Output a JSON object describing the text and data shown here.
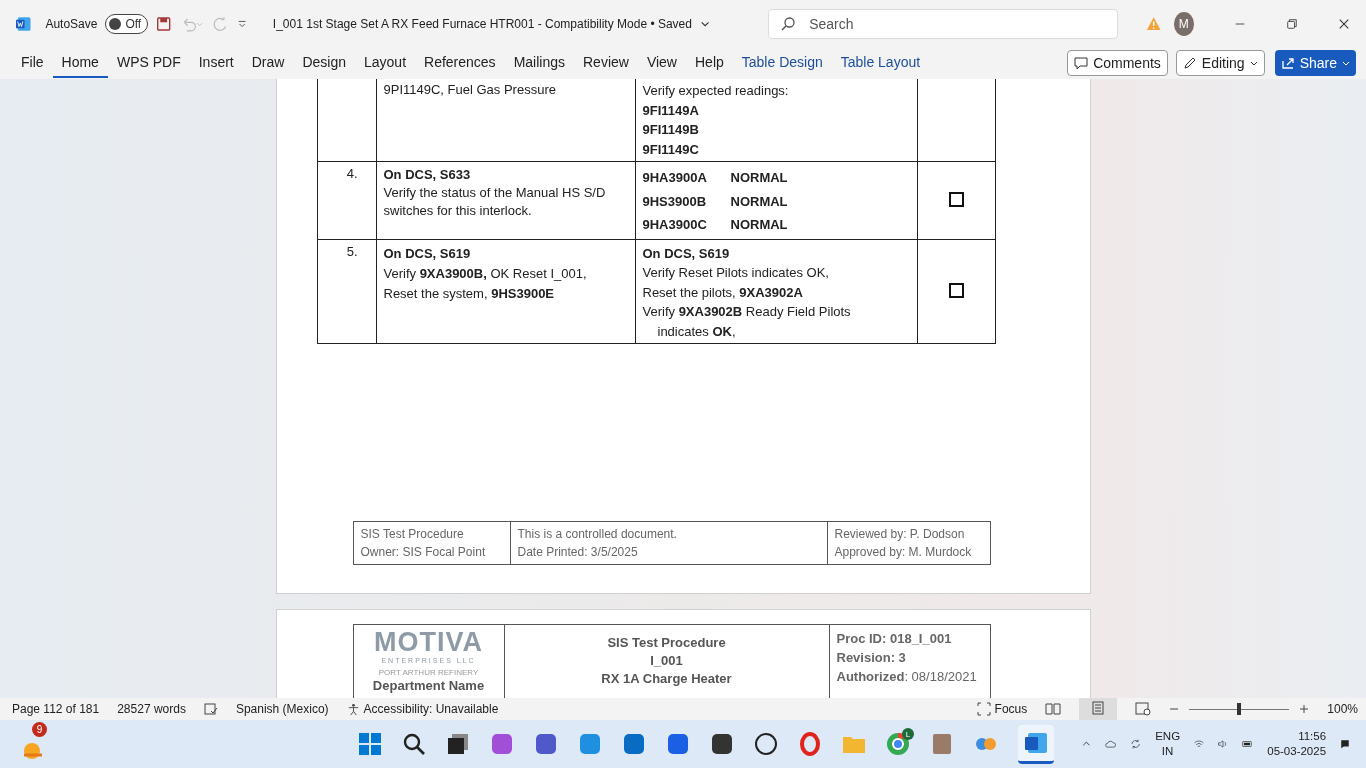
{
  "titlebar": {
    "autosave_label": "AutoSave",
    "autosave_on": false,
    "autosave_state": "Off",
    "doc_title": "I_001 1st Stage Set A RX Feed Furnace HTR001  -  Compatibility Mode • Saved",
    "search_placeholder": "Search",
    "avatar": "M"
  },
  "ribbon": {
    "tabs": [
      {
        "label": "File",
        "selected": false,
        "kind": "normal"
      },
      {
        "label": "Home",
        "selected": true,
        "kind": "normal"
      },
      {
        "label": "WPS PDF",
        "selected": false,
        "kind": "normal"
      },
      {
        "label": "Insert",
        "selected": false,
        "kind": "normal"
      },
      {
        "label": "Draw",
        "selected": false,
        "kind": "normal"
      },
      {
        "label": "Design",
        "selected": false,
        "kind": "normal"
      },
      {
        "label": "Layout",
        "selected": false,
        "kind": "normal"
      },
      {
        "label": "References",
        "selected": false,
        "kind": "normal"
      },
      {
        "label": "Mailings",
        "selected": false,
        "kind": "normal"
      },
      {
        "label": "Review",
        "selected": false,
        "kind": "normal"
      },
      {
        "label": "View",
        "selected": false,
        "kind": "normal"
      },
      {
        "label": "Help",
        "selected": false,
        "kind": "normal"
      },
      {
        "label": "Table Design",
        "selected": false,
        "kind": "contextual"
      },
      {
        "label": "Table Layout",
        "selected": false,
        "kind": "contextual"
      }
    ],
    "comments": "Comments",
    "editing": "Editing",
    "share": "Share"
  },
  "table": {
    "rows": [
      {
        "number": "",
        "action": [
          "9PI1149C, Fuel Gas Pressure"
        ],
        "expected": [
          {
            "kind": "text",
            "text": "Verify expected readings:"
          },
          {
            "kind": "bold",
            "text": "9FI1149A"
          },
          {
            "kind": "bold",
            "text": "9FI1149B"
          },
          {
            "kind": "bold",
            "text": "9FI1149C"
          }
        ]
      },
      {
        "number": "4.",
        "action": [
          "**On DCS, S633**",
          "Verify the status of the Manual HS S/D switches for this interlock."
        ],
        "expected": [
          {
            "kind": "status",
            "text": "9HA3900A",
            "state": "NORMAL"
          },
          {
            "kind": "status",
            "text": "9HS3900B",
            "state": "NORMAL"
          },
          {
            "kind": "status",
            "text": "9HA3900C",
            "state": "NORMAL"
          }
        ],
        "checked": false
      },
      {
        "number": "5.",
        "action": [
          "**On DCS, S619**",
          "Verify **9XA3900B,** OK Reset I_001,",
          "Reset the system, **9HS3900E**"
        ],
        "expected": [
          {
            "kind": "bold",
            "text": "On DCS, S619"
          },
          {
            "kind": "text",
            "text": "Verify Reset Pilots indicates OK,"
          },
          {
            "kind": "text",
            "text": "Reset the pilots, **9XA3902A**"
          },
          {
            "kind": "text",
            "text": "Verify **9XA3902B** Ready Field Pilots"
          },
          {
            "kind": "indent",
            "text": "indicates **OK**,"
          }
        ],
        "checked": false
      }
    ]
  },
  "footer": [
    [
      "SIS Test Procedure",
      "Owner: SIS Focal Point"
    ],
    [
      "This is a controlled document.",
      "Date Printed: 3/5/2025"
    ],
    [
      "Reviewed by: P. Dodson",
      "Approved by: M. Murdock"
    ]
  ],
  "next_header": {
    "logo": "MOTIVA",
    "logo_sub": "ENTERPRISES LLC",
    "refinery": "PORT ARTHUR REFINERY",
    "department": "Department Name",
    "center": [
      "SIS Test Procedure",
      "I_001",
      "RX 1A Charge Heater"
    ],
    "right": [
      "**Proc ID: 018_I_001**",
      "**Revision: 3**",
      "**Authorized**: 08/18/2021"
    ]
  },
  "status_bar": {
    "page": "Page 112 of 181",
    "words": "28527 words",
    "language": "Spanish (Mexico)",
    "accessibility": "Accessibility: Unavailable",
    "focus": "Focus",
    "zoom": "100%",
    "zoom_slider": {
      "level": 0.5
    }
  },
  "taskbar": {
    "badge": "9",
    "chrome_badge": "L",
    "lang": [
      "ENG",
      "IN"
    ],
    "time": "11:56",
    "date": "05-03-2025"
  }
}
